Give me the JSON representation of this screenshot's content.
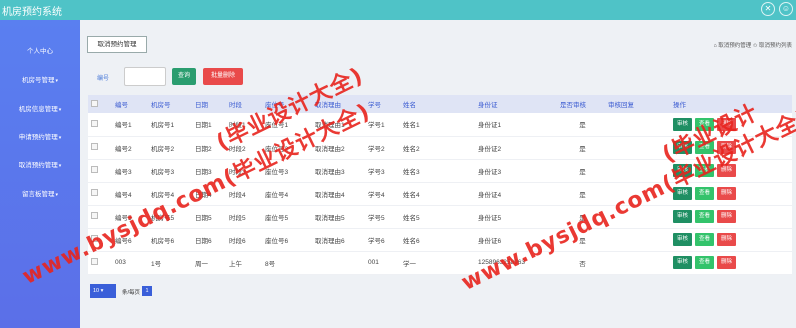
{
  "app": {
    "title": "机房预约系统"
  },
  "sidebar": {
    "items": [
      {
        "label": "个人中心"
      },
      {
        "label": "机房号管理"
      },
      {
        "label": "机房信息管理"
      },
      {
        "label": "申请预约管理"
      },
      {
        "label": "取消预约管理"
      },
      {
        "label": "留言板管理"
      }
    ]
  },
  "tab": {
    "label": "取消预约管理"
  },
  "breadcrumb": {
    "home": "取消预约管理",
    "current": "取消预约列表"
  },
  "search": {
    "label": "编号",
    "value": "",
    "search_button": "查询",
    "batch_delete_button": "批量删除"
  },
  "table": {
    "headers": [
      "编号",
      "机房号",
      "日期",
      "时段",
      "座位号",
      "取消理由",
      "学号",
      "姓名",
      "身份证",
      "是否审核",
      "审核回复",
      "操作"
    ],
    "rows": [
      [
        "编号1",
        "机房号1",
        "日期1",
        "时段1",
        "座位号1",
        "取消理由1",
        "学号1",
        "姓名1",
        "身份证1",
        "是",
        ""
      ],
      [
        "编号2",
        "机房号2",
        "日期2",
        "时段2",
        "座位号2",
        "取消理由2",
        "学号2",
        "姓名2",
        "身份证2",
        "是",
        ""
      ],
      [
        "编号3",
        "机房号3",
        "日期3",
        "时段3",
        "座位号3",
        "取消理由3",
        "学号3",
        "姓名3",
        "身份证3",
        "是",
        ""
      ],
      [
        "编号4",
        "机房号4",
        "日期4",
        "时段4",
        "座位号4",
        "取消理由4",
        "学号4",
        "姓名4",
        "身份证4",
        "是",
        ""
      ],
      [
        "编号5",
        "机房号5",
        "日期5",
        "时段5",
        "座位号5",
        "取消理由5",
        "学号5",
        "姓名5",
        "身份证5",
        "是",
        ""
      ],
      [
        "编号6",
        "机房号6",
        "日期6",
        "时段6",
        "座位号6",
        "取消理由6",
        "学号6",
        "姓名6",
        "身份证6",
        "是",
        ""
      ],
      [
        "003",
        "1号",
        "周一",
        "上午",
        "8号",
        "",
        "001",
        "学一",
        "1258963258963",
        "否",
        ""
      ]
    ],
    "actions": {
      "audit": "审核",
      "view": "查看",
      "delete": "删除"
    }
  },
  "pager": {
    "page_size": "10",
    "text": "条/每页",
    "current_page": "1"
  },
  "watermarks": [
    "www.bysjdq.com(毕业设计大全)",
    "www.bysjdq.com(毕业设计大全)",
    "(毕业设计大全)",
    "(毕业设计"
  ],
  "colors": {
    "topbar": "#4fc3c7",
    "sidebar": "#5b6fe8",
    "header_text": "#3b5bd1",
    "audit": "#1f8f63",
    "view": "#33c36b",
    "delete": "#e94a4a",
    "watermark": "#e8241e"
  }
}
